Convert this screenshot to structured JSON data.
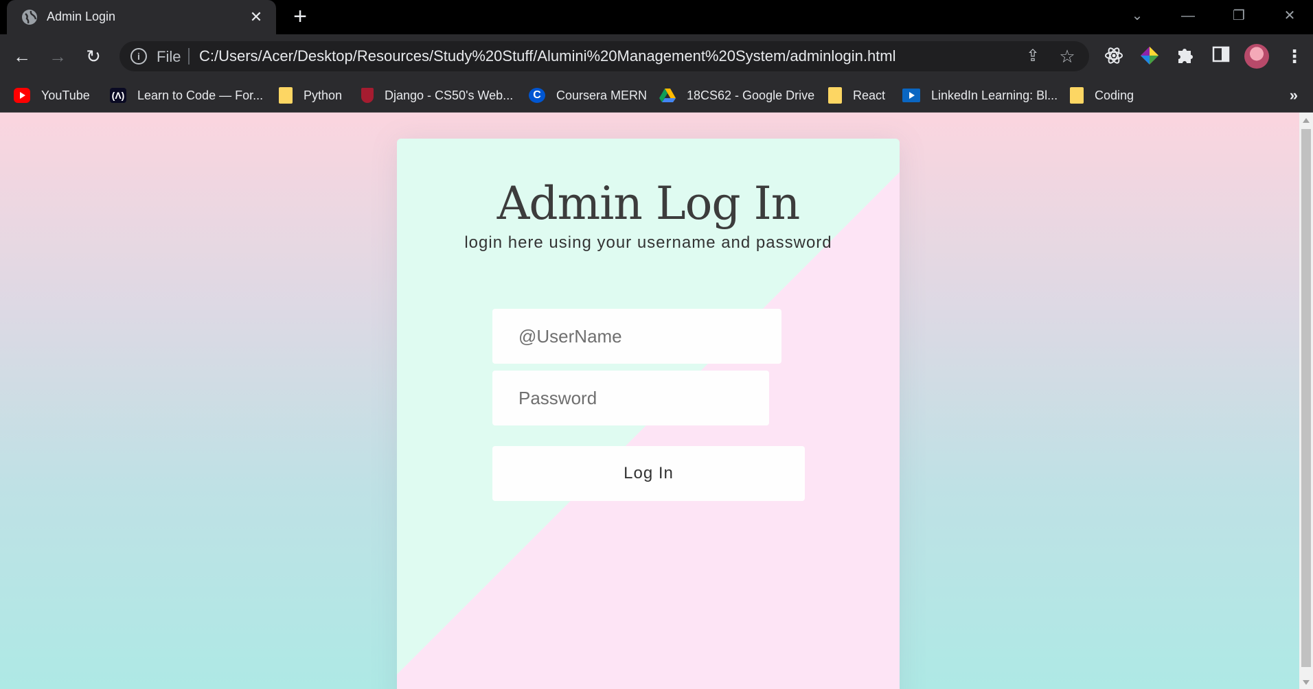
{
  "tab": {
    "title": "Admin Login",
    "close": "✕",
    "new": "+"
  },
  "window_controls": {
    "dropdown": "⌄",
    "minimize": "—",
    "restore": "❐",
    "close": "✕"
  },
  "toolbar": {
    "back": "←",
    "forward": "→",
    "reload": "↻",
    "scheme_label": "File",
    "url": "C:/Users/Acer/Desktop/Resources/Study%20Stuff/Alumini%20Management%20System/adminlogin.html"
  },
  "bookmarks": [
    {
      "label": "YouTube",
      "icon": "youtube-icon"
    },
    {
      "label": "Learn to Code — For...",
      "icon": "freecodecamp-icon"
    },
    {
      "label": "Python",
      "icon": "folder-icon"
    },
    {
      "label": "Django - CS50's Web...",
      "icon": "harvard-icon"
    },
    {
      "label": "Coursera MERN",
      "icon": "coursera-icon"
    },
    {
      "label": "18CS62 - Google Drive",
      "icon": "google-drive-icon"
    },
    {
      "label": "React",
      "icon": "folder-icon"
    },
    {
      "label": "LinkedIn Learning: Bl...",
      "icon": "linkedin-learning-icon"
    },
    {
      "label": "Coding",
      "icon": "folder-icon"
    }
  ],
  "bookmarks_more": "»",
  "login": {
    "heading": "Admin Log In",
    "subtitle": "login here using your username and password",
    "username_placeholder": "@UserName",
    "password_placeholder": "Password",
    "submit_label": "Log In"
  }
}
